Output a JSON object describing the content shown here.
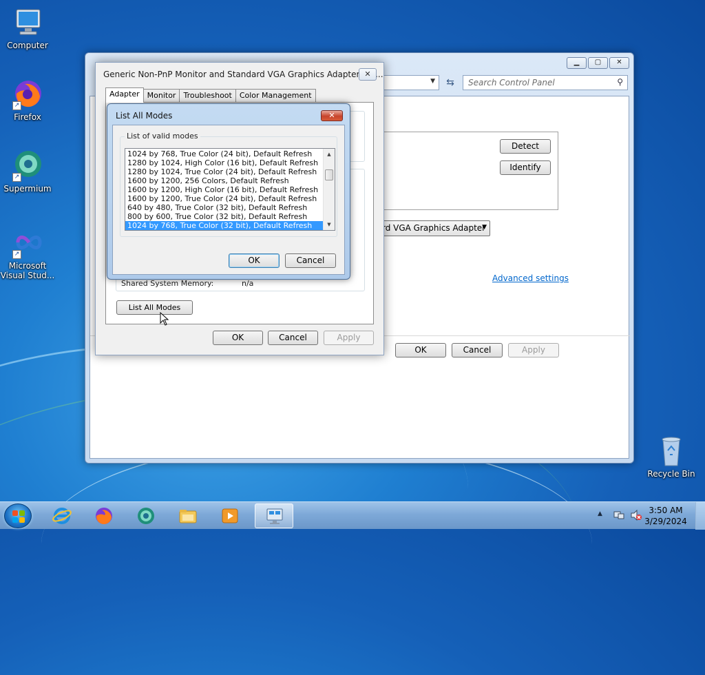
{
  "desktop": {
    "icons": [
      {
        "label": "Computer",
        "icon": "computer-icon"
      },
      {
        "label": "Firefox",
        "icon": "firefox-icon"
      },
      {
        "label": "Supermium",
        "icon": "supermium-icon"
      },
      {
        "label": "Microsoft Visual Stud...",
        "icon": "visual-studio-icon"
      },
      {
        "label": "Recycle Bin",
        "icon": "recycle-bin-icon"
      }
    ]
  },
  "control_panel": {
    "search_placeholder": "Search Control Panel",
    "detect_label": "Detect",
    "identify_label": "Identify",
    "adapter_dropdown_value": "rd VGA Graphics Adapter",
    "advanced_link": "Advanced settings",
    "ok_label": "OK",
    "cancel_label": "Cancel",
    "apply_label": "Apply"
  },
  "properties_dialog": {
    "title": "Generic Non-PnP Monitor and Standard VGA Graphics Adapter Pro...",
    "tabs": [
      "Adapter",
      "Monitor",
      "Troubleshoot",
      "Color Management"
    ],
    "active_tab": "Adapter",
    "shared_memory_label": "Shared System Memory:",
    "shared_memory_value": "n/a",
    "list_all_modes_label": "List All Modes",
    "ok_label": "OK",
    "cancel_label": "Cancel",
    "apply_label": "Apply"
  },
  "list_all_modes_dialog": {
    "title": "List All Modes",
    "group_title": "List of valid modes",
    "modes": [
      "1024 by 768, True Color (24 bit), Default Refresh",
      "1280 by 1024, High Color (16 bit), Default Refresh",
      "1280 by 1024, True Color (24 bit), Default Refresh",
      "1600 by 1200, 256 Colors, Default Refresh",
      "1600 by 1200, High Color (16 bit), Default Refresh",
      "1600 by 1200, True Color (24 bit), Default Refresh",
      "640 by 480, True Color (32 bit), Default Refresh",
      "800 by 600, True Color (32 bit), Default Refresh",
      "1024 by 768, True Color (32 bit), Default Refresh"
    ],
    "selected_index": 8,
    "ok_label": "OK",
    "cancel_label": "Cancel"
  },
  "taskbar": {
    "items": [
      "internet-explorer-icon",
      "firefox-icon",
      "supermium-icon",
      "file-explorer-icon",
      "media-player-icon",
      "display-settings-icon"
    ],
    "active_item": "display-settings-icon",
    "time": "3:50 AM",
    "date": "3/29/2024"
  },
  "colors": {
    "selection": "#3399ff",
    "link": "#0066cc",
    "close_red": "#c7442c"
  }
}
